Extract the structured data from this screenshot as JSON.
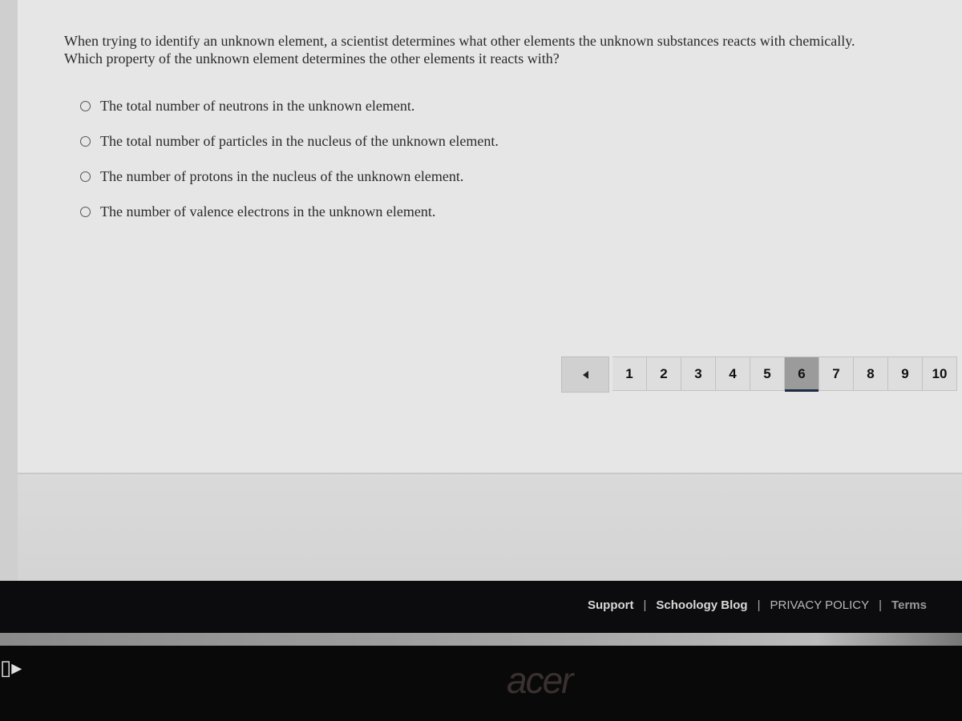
{
  "question": {
    "line1": "When trying to identify an unknown element, a scientist determines what other elements the unknown substances reacts with chemically.",
    "line2": "Which property of the unknown element determines the other elements it reacts with?",
    "choices": [
      "The total number of neutrons in the unknown element.",
      "The total number of particles in the nucleus of the unknown element.",
      "The number of protons in the nucleus of the unknown element.",
      "The number of valence electrons in the unknown element."
    ]
  },
  "pagination": {
    "prev_icon": "triangle-left-icon",
    "pages": [
      "1",
      "2",
      "3",
      "4",
      "5",
      "6",
      "7",
      "8",
      "9",
      "10"
    ],
    "current": "6"
  },
  "footer": {
    "links": [
      "Support",
      "Schoology Blog",
      "PRIVACY POLICY",
      "Terms"
    ],
    "separator": "|"
  },
  "bezel": {
    "logo": "acer"
  },
  "colors": {
    "active_page": "#9b9b9b",
    "active_underline": "#1f2b44",
    "footer_bg": "#0c0c0e"
  }
}
